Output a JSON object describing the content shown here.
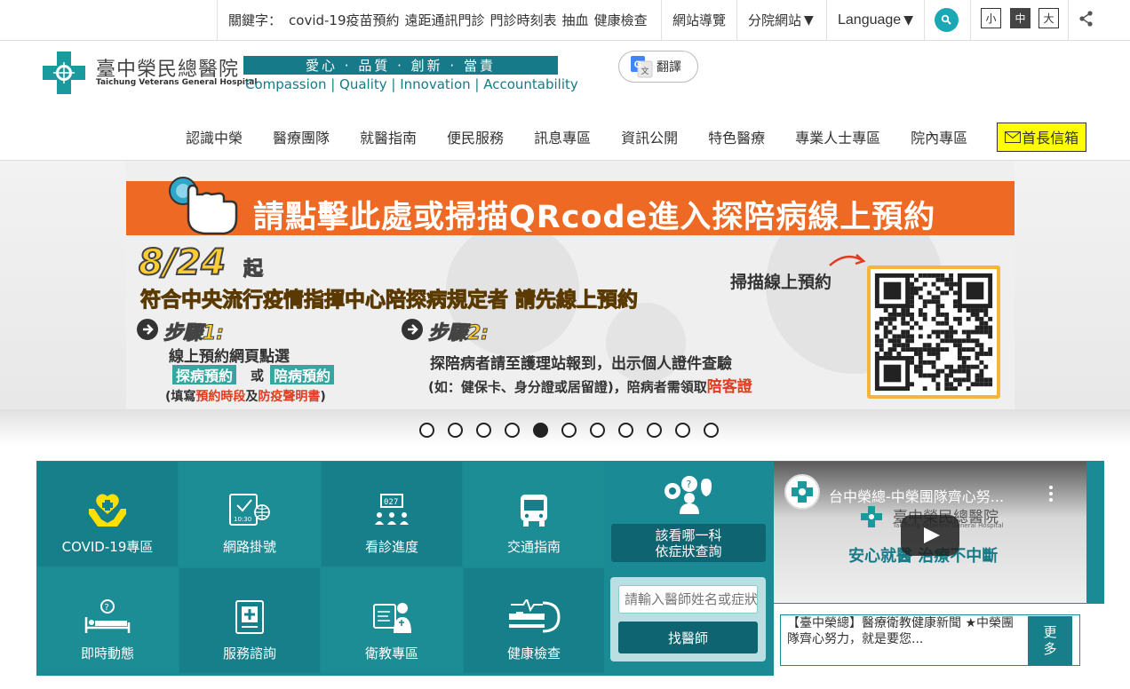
{
  "topbar": {
    "keywords_label": "關鍵字：",
    "keywords": [
      "covid-19疫苗預約",
      "遠距通訊門診",
      "門診時刻表",
      "抽血",
      "健康檢查"
    ],
    "sitemap": "網站導覽",
    "branches": "分院網站",
    "language": "Language",
    "font_sizes": [
      "小",
      "中",
      "大"
    ],
    "active_font_size": "中"
  },
  "header": {
    "logo_cn": "臺中榮民總醫院",
    "logo_en": "Taichung Veterans General Hospital",
    "slogan_cn": "愛心 · 品質 · 創新 · 當責",
    "slogan_en": "Compassion | Quality | Innovation | Accountability",
    "translate": "翻譯"
  },
  "nav": {
    "items": [
      "認識中榮",
      "醫療團隊",
      "就醫指南",
      "便民服務",
      "訊息專區",
      "資訊公開",
      "特色醫療",
      "專業人士專區",
      "院內專區"
    ],
    "mailbox": "首長信箱"
  },
  "banner": {
    "title": "請點擊此處或掃描QRcode進入探陪病線上預約",
    "date": "8/24",
    "date_suffix": "起",
    "subtitle": "符合中央流行疫情指揮中心陪探病規定者 請先線上預約",
    "step1_label": "步驟1:",
    "step1_line1": "線上預約網頁點選",
    "step1_tag1": "探病預約",
    "step1_or": "或",
    "step1_tag2": "陪病預約",
    "step1_note_prefix": "(填寫",
    "step1_note_red1": "預約時段",
    "step1_note_mid": "及",
    "step1_note_red2": "防疫聲明書",
    "step1_note_suffix": ")",
    "step2_label": "步驟2:",
    "step2_line1": "探陪病者請至護理站報到，出示個人證件查驗",
    "step2_line2_prefix": "(如：健保卡、身分證或居留證)，陪病者需領取",
    "step2_line2_red": "陪客證",
    "scan_label": "掃描線上預約",
    "slide_count": 11,
    "active_slide": 5
  },
  "services": {
    "tiles": [
      {
        "label": "COVID-19專區",
        "icon": "covid-care-icon"
      },
      {
        "label": "網路掛號",
        "icon": "online-registration-icon"
      },
      {
        "label": "看診進度",
        "icon": "clinic-progress-icon"
      },
      {
        "label": "交通指南",
        "icon": "bus-icon"
      },
      {
        "label": "即時動態",
        "icon": "bed-status-icon"
      },
      {
        "label": "服務諮詢",
        "icon": "service-consult-icon"
      },
      {
        "label": "衛教專區",
        "icon": "health-education-icon"
      },
      {
        "label": "健康檢查",
        "icon": "health-checkup-icon"
      }
    ],
    "symptom_line1": "該看哪一科",
    "symptom_line2": "依症狀查詢",
    "doctor_placeholder": "請輸入醫師姓名或症狀",
    "doctor_button": "找醫師"
  },
  "video": {
    "title": "台中榮總-中榮團隊齊心努...",
    "brand": "臺中榮民總醫院",
    "brand_en": "Taichung Veterans General Hospital",
    "tagline": "安心就醫 治療不中斷"
  },
  "news": {
    "text": "【臺中榮總】醫療衛教健康新聞 ★中榮團隊齊心努力，就是要您...",
    "more_line1": "更",
    "more_line2": "多"
  },
  "colors": {
    "teal": "#177f89",
    "teal_dark": "#0f6472",
    "orange": "#ee6a24",
    "yellow_highlight": "#ffff00",
    "gold": "#ffcc33"
  }
}
